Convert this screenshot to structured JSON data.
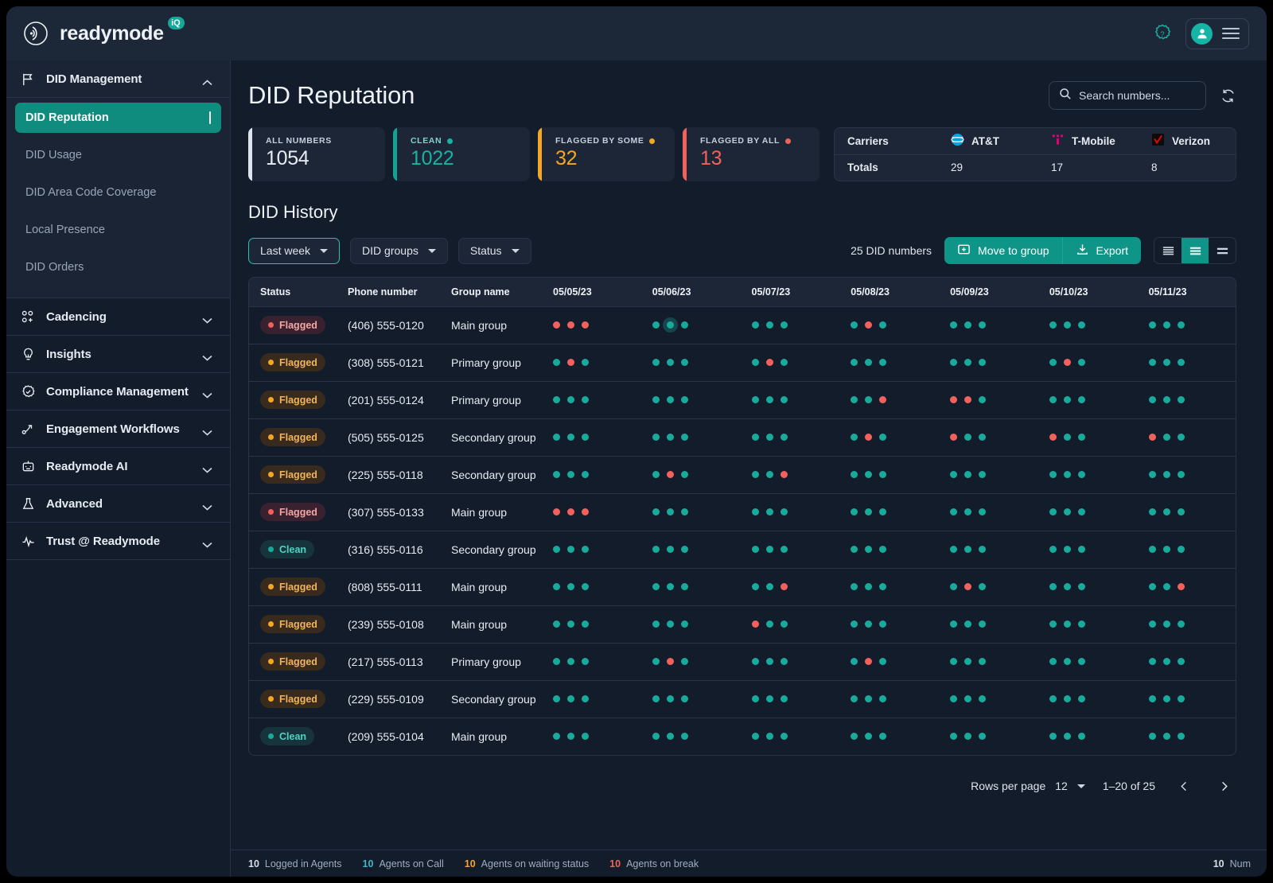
{
  "brand": {
    "name": "readymode",
    "badge": "iQ"
  },
  "topbar": {
    "help_icon": "help-circle-icon",
    "avatar_icon": "user-icon",
    "menu_icon": "hamburger-icon"
  },
  "sidebar": {
    "groups": [
      {
        "label": "DID Management",
        "icon": "flag-icon",
        "expanded": true,
        "items": [
          {
            "label": "DID Reputation",
            "active": true
          },
          {
            "label": "DID Usage",
            "active": false
          },
          {
            "label": "DID Area Code Coverage",
            "active": false
          },
          {
            "label": "Local Presence",
            "active": false
          },
          {
            "label": "DID Orders",
            "active": false
          }
        ]
      },
      {
        "label": "Cadencing",
        "icon": "nodes-icon",
        "expanded": false,
        "items": []
      },
      {
        "label": "Insights",
        "icon": "lightbulb-icon",
        "expanded": false,
        "items": []
      },
      {
        "label": "Compliance Management",
        "icon": "shield-check-icon",
        "expanded": false,
        "items": []
      },
      {
        "label": "Engagement Workflows",
        "icon": "workflow-arrow-icon",
        "expanded": false,
        "items": []
      },
      {
        "label": "Readymode AI",
        "icon": "robot-icon",
        "expanded": false,
        "items": []
      },
      {
        "label": "Advanced",
        "icon": "flask-icon",
        "expanded": false,
        "items": []
      },
      {
        "label": "Trust @ Readymode",
        "icon": "pulse-icon",
        "expanded": false,
        "items": []
      }
    ]
  },
  "page": {
    "title": "DID Reputation"
  },
  "search": {
    "placeholder": "Search numbers...",
    "value": "",
    "icon": "search-icon"
  },
  "refresh": {
    "icon": "refresh-icon"
  },
  "stats": [
    {
      "label": "ALL NUMBERS",
      "value": "1054",
      "color": "#e8edf4",
      "accent": "#dfe5ee",
      "dot": false
    },
    {
      "label": "CLEAN",
      "value": "1022",
      "color": "#19b3a3",
      "accent": "#13a294",
      "dot": true
    },
    {
      "label": "FLAGGED BY SOME",
      "value": "32",
      "color": "#f5a623",
      "accent": "#f5a623",
      "dot": true
    },
    {
      "label": "FLAGGED BY ALL",
      "value": "13",
      "color": "#f2615c",
      "accent": "#f2615c",
      "dot": true
    }
  ],
  "carriers": {
    "row_label": "Carriers",
    "totals_label": "Totals",
    "items": [
      {
        "name": "AT&T",
        "icon": "att-globe-icon",
        "total": "29"
      },
      {
        "name": "T-Mobile",
        "icon": "tmobile-icon",
        "total": "17"
      },
      {
        "name": "Verizon",
        "icon": "verizon-check-icon",
        "total": "8"
      }
    ]
  },
  "history": {
    "title": "DID History",
    "filters": [
      {
        "label": "Last week",
        "selected": true
      },
      {
        "label": "DID groups",
        "selected": false
      },
      {
        "label": "Status",
        "selected": false
      }
    ],
    "count_text": "25 DID numbers",
    "actions": [
      {
        "label": "Move to group",
        "icon": "add-to-folder-icon"
      },
      {
        "label": "Export",
        "icon": "download-icon"
      }
    ],
    "density": [
      {
        "icon": "density-compact-icon",
        "active": false
      },
      {
        "icon": "density-medium-icon",
        "active": true
      },
      {
        "icon": "density-comfortable-icon",
        "active": false
      }
    ],
    "columns": [
      "Status",
      "Phone number",
      "Group name",
      "05/05/23",
      "05/06/23",
      "05/07/23",
      "05/08/23",
      "05/09/23",
      "05/10/23",
      "05/11/23"
    ],
    "rows": [
      {
        "status": "Flagged",
        "status_type": "red",
        "phone": "(406) 555-0120",
        "group": "Main group",
        "days": [
          [
            "r",
            "r",
            "r"
          ],
          [
            "t",
            "t-sel",
            "t"
          ],
          [
            "t",
            "t",
            "t"
          ],
          [
            "t",
            "r",
            "t"
          ],
          [
            "t",
            "t",
            "t"
          ],
          [
            "t",
            "t",
            "t"
          ],
          [
            "t",
            "t",
            "t"
          ]
        ]
      },
      {
        "status": "Flagged",
        "status_type": "amber",
        "phone": "(308) 555-0121",
        "group": "Primary group",
        "days": [
          [
            "t",
            "r",
            "t"
          ],
          [
            "t",
            "t",
            "t"
          ],
          [
            "t",
            "r",
            "t"
          ],
          [
            "t",
            "t",
            "t"
          ],
          [
            "t",
            "t",
            "t"
          ],
          [
            "t",
            "r",
            "t"
          ],
          [
            "t",
            "t",
            "t"
          ]
        ]
      },
      {
        "status": "Flagged",
        "status_type": "amber",
        "phone": "(201) 555-0124",
        "group": "Primary group",
        "days": [
          [
            "t",
            "t",
            "t"
          ],
          [
            "t",
            "t",
            "t"
          ],
          [
            "t",
            "t",
            "t"
          ],
          [
            "t",
            "t",
            "r"
          ],
          [
            "r",
            "r",
            "t"
          ],
          [
            "t",
            "t",
            "t"
          ],
          [
            "t",
            "t",
            "t"
          ]
        ]
      },
      {
        "status": "Flagged",
        "status_type": "amber",
        "phone": "(505) 555-0125",
        "group": "Secondary group",
        "days": [
          [
            "t",
            "t",
            "t"
          ],
          [
            "t",
            "t",
            "t"
          ],
          [
            "t",
            "t",
            "t"
          ],
          [
            "t",
            "r",
            "t"
          ],
          [
            "r",
            "t",
            "t"
          ],
          [
            "r",
            "t",
            "t"
          ],
          [
            "r",
            "t",
            "t"
          ]
        ]
      },
      {
        "status": "Flagged",
        "status_type": "amber",
        "phone": "(225) 555-0118",
        "group": "Secondary group",
        "days": [
          [
            "t",
            "t",
            "t"
          ],
          [
            "t",
            "r",
            "t"
          ],
          [
            "t",
            "t",
            "r"
          ],
          [
            "t",
            "t",
            "t"
          ],
          [
            "t",
            "t",
            "t"
          ],
          [
            "t",
            "t",
            "t"
          ],
          [
            "t",
            "t",
            "t"
          ]
        ]
      },
      {
        "status": "Flagged",
        "status_type": "red",
        "phone": "(307) 555-0133",
        "group": "Main group",
        "days": [
          [
            "r",
            "r",
            "r"
          ],
          [
            "t",
            "t",
            "t"
          ],
          [
            "t",
            "t",
            "t"
          ],
          [
            "t",
            "t",
            "t"
          ],
          [
            "t",
            "t",
            "t"
          ],
          [
            "t",
            "t",
            "t"
          ],
          [
            "t",
            "t",
            "t"
          ]
        ]
      },
      {
        "status": "Clean",
        "status_type": "teal",
        "phone": "(316) 555-0116",
        "group": "Secondary group",
        "days": [
          [
            "t",
            "t",
            "t"
          ],
          [
            "t",
            "t",
            "t"
          ],
          [
            "t",
            "t",
            "t"
          ],
          [
            "t",
            "t",
            "t"
          ],
          [
            "t",
            "t",
            "t"
          ],
          [
            "t",
            "t",
            "t"
          ],
          [
            "t",
            "t",
            "t"
          ]
        ]
      },
      {
        "status": "Flagged",
        "status_type": "amber",
        "phone": "(808) 555-0111",
        "group": "Main group",
        "days": [
          [
            "t",
            "t",
            "t"
          ],
          [
            "t",
            "t",
            "t"
          ],
          [
            "t",
            "t",
            "r"
          ],
          [
            "t",
            "t",
            "t"
          ],
          [
            "t",
            "r",
            "t"
          ],
          [
            "t",
            "t",
            "t"
          ],
          [
            "t",
            "t",
            "r"
          ]
        ]
      },
      {
        "status": "Flagged",
        "status_type": "amber",
        "phone": "(239) 555-0108",
        "group": "Main group",
        "days": [
          [
            "t",
            "t",
            "t"
          ],
          [
            "t",
            "t",
            "t"
          ],
          [
            "r",
            "t",
            "t"
          ],
          [
            "t",
            "t",
            "t"
          ],
          [
            "t",
            "t",
            "t"
          ],
          [
            "t",
            "t",
            "t"
          ],
          [
            "t",
            "t",
            "t"
          ]
        ]
      },
      {
        "status": "Flagged",
        "status_type": "amber",
        "phone": "(217) 555-0113",
        "group": "Primary group",
        "days": [
          [
            "t",
            "t",
            "t"
          ],
          [
            "t",
            "r",
            "t"
          ],
          [
            "t",
            "t",
            "t"
          ],
          [
            "t",
            "r",
            "t"
          ],
          [
            "t",
            "t",
            "t"
          ],
          [
            "t",
            "t",
            "t"
          ],
          [
            "t",
            "t",
            "t"
          ]
        ]
      },
      {
        "status": "Flagged",
        "status_type": "amber",
        "phone": "(229) 555-0109",
        "group": "Secondary group",
        "days": [
          [
            "t",
            "t",
            "t"
          ],
          [
            "t",
            "t",
            "t"
          ],
          [
            "t",
            "t",
            "t"
          ],
          [
            "t",
            "t",
            "t"
          ],
          [
            "t",
            "t",
            "t"
          ],
          [
            "t",
            "t",
            "t"
          ],
          [
            "t",
            "t",
            "t"
          ]
        ]
      },
      {
        "status": "Clean",
        "status_type": "teal",
        "phone": "(209) 555-0104",
        "group": "Main group",
        "days": [
          [
            "t",
            "t",
            "t"
          ],
          [
            "t",
            "t",
            "t"
          ],
          [
            "t",
            "t",
            "t"
          ],
          [
            "t",
            "t",
            "t"
          ],
          [
            "t",
            "t",
            "t"
          ],
          [
            "t",
            "t",
            "t"
          ],
          [
            "t",
            "t",
            "t"
          ]
        ]
      }
    ]
  },
  "pagination": {
    "rows_per_page_label": "Rows per page",
    "rows_per_page_value": "12",
    "range_text": "1–20 of 25",
    "prev_icon": "chevron-left-icon",
    "next_icon": "chevron-right-icon"
  },
  "statusbar": {
    "items": [
      {
        "num": "10",
        "label": "Logged in Agents",
        "color": "#d6dde7"
      },
      {
        "num": "10",
        "label": "Agents on Call",
        "color": "#3fb6c8"
      },
      {
        "num": "10",
        "label": "Agents on waiting status",
        "color": "#f5a623"
      },
      {
        "num": "10",
        "label": "Agents on break",
        "color": "#f2615c"
      }
    ],
    "right": {
      "num": "10",
      "label": "Num",
      "color": "#d6dde7"
    }
  },
  "colors": {
    "teal": "#18aa9b",
    "red": "#f2615c",
    "amber": "#f5a623",
    "accent": "#0f9488"
  }
}
